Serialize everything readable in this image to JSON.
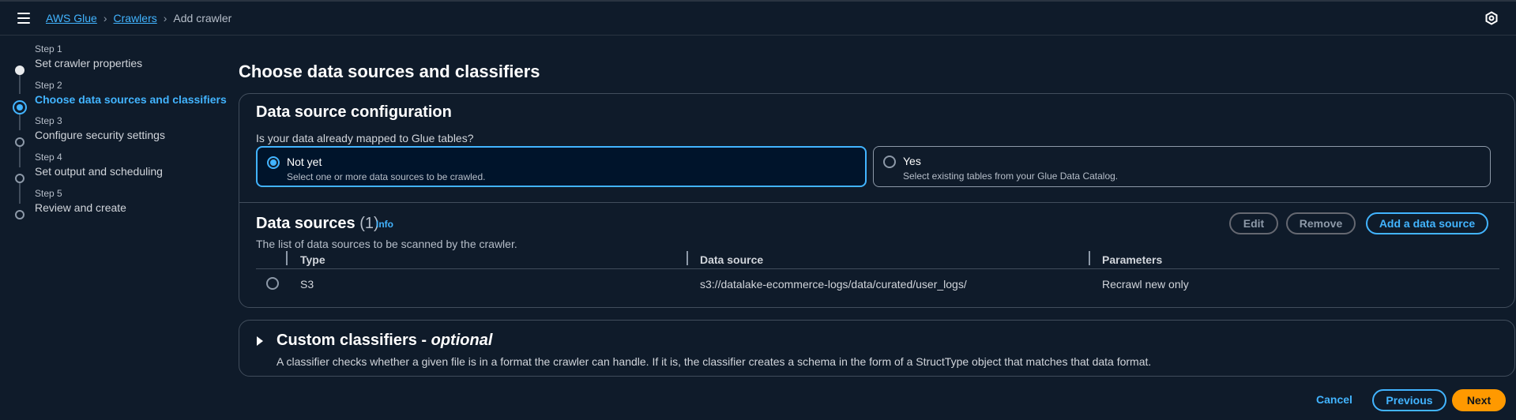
{
  "header": {
    "breadcrumb": [
      "AWS Glue",
      "Crawlers",
      "Add crawler"
    ],
    "menu_icon": "hamburger-menu-icon",
    "settings_icon": "gear-icon"
  },
  "steps": [
    {
      "num": "Step 1",
      "title": "Set crawler properties",
      "state": "done"
    },
    {
      "num": "Step 2",
      "title": "Choose data sources and classifiers",
      "state": "active"
    },
    {
      "num": "Step 3",
      "title": "Configure security settings",
      "state": "pending"
    },
    {
      "num": "Step 4",
      "title": "Set output and scheduling",
      "state": "pending"
    },
    {
      "num": "Step 5",
      "title": "Review and create",
      "state": "pending"
    }
  ],
  "main": {
    "title": "Choose data sources and classifiers",
    "config": {
      "title": "Data source configuration",
      "question": "Is your data already mapped to Glue tables?",
      "options": [
        {
          "label": "Not yet",
          "description": "Select one or more data sources to be crawled.",
          "selected": true
        },
        {
          "label": "Yes",
          "description": "Select existing tables from your Glue Data Catalog.",
          "selected": false
        }
      ]
    },
    "sources": {
      "title": "Data sources",
      "count": "(1)",
      "info": "Info",
      "description": "The list of data sources to be scanned by the crawler.",
      "buttons": {
        "edit": "Edit",
        "remove": "Remove",
        "add": "Add a data source"
      },
      "columns": [
        "Type",
        "Data source",
        "Parameters"
      ],
      "rows": [
        {
          "type": "S3",
          "source": "s3://datalake-ecommerce-logs/data/curated/user_logs/",
          "params": "Recrawl new only"
        }
      ]
    },
    "classifiers": {
      "title": "Custom classifiers - ",
      "optional": "optional",
      "description": "A classifier checks whether a given file is in a format the crawler can handle. If it is, the classifier creates a schema in the form of a StructType object that matches that data format."
    }
  },
  "footer": {
    "cancel": "Cancel",
    "previous": "Previous",
    "next": "Next"
  },
  "colors": {
    "accent": "#42b4ff",
    "primary": "#ff9900",
    "background": "#0f1b2a"
  }
}
